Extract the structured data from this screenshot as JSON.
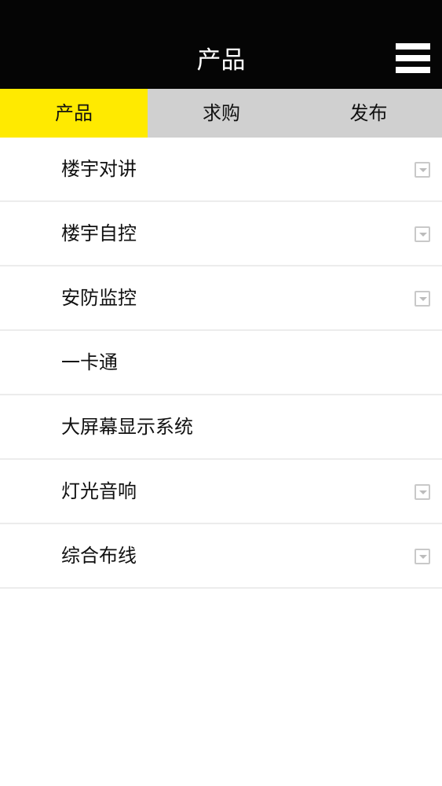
{
  "header": {
    "title": "产品"
  },
  "tabs": [
    {
      "label": "产品",
      "active": true
    },
    {
      "label": "求购",
      "active": false
    },
    {
      "label": "发布",
      "active": false
    }
  ],
  "list": {
    "items": [
      {
        "label": "楼宇对讲",
        "expandable": true
      },
      {
        "label": "楼宇自控",
        "expandable": true
      },
      {
        "label": "安防监控",
        "expandable": true
      },
      {
        "label": "一卡通",
        "expandable": false
      },
      {
        "label": "大屏幕显示系统",
        "expandable": false
      },
      {
        "label": "灯光音响",
        "expandable": true
      },
      {
        "label": "综合布线",
        "expandable": true
      }
    ]
  },
  "colors": {
    "header_bg": "#050505",
    "active_tab": "#ffea00",
    "tab_bar_bg": "#d0d0d0"
  }
}
